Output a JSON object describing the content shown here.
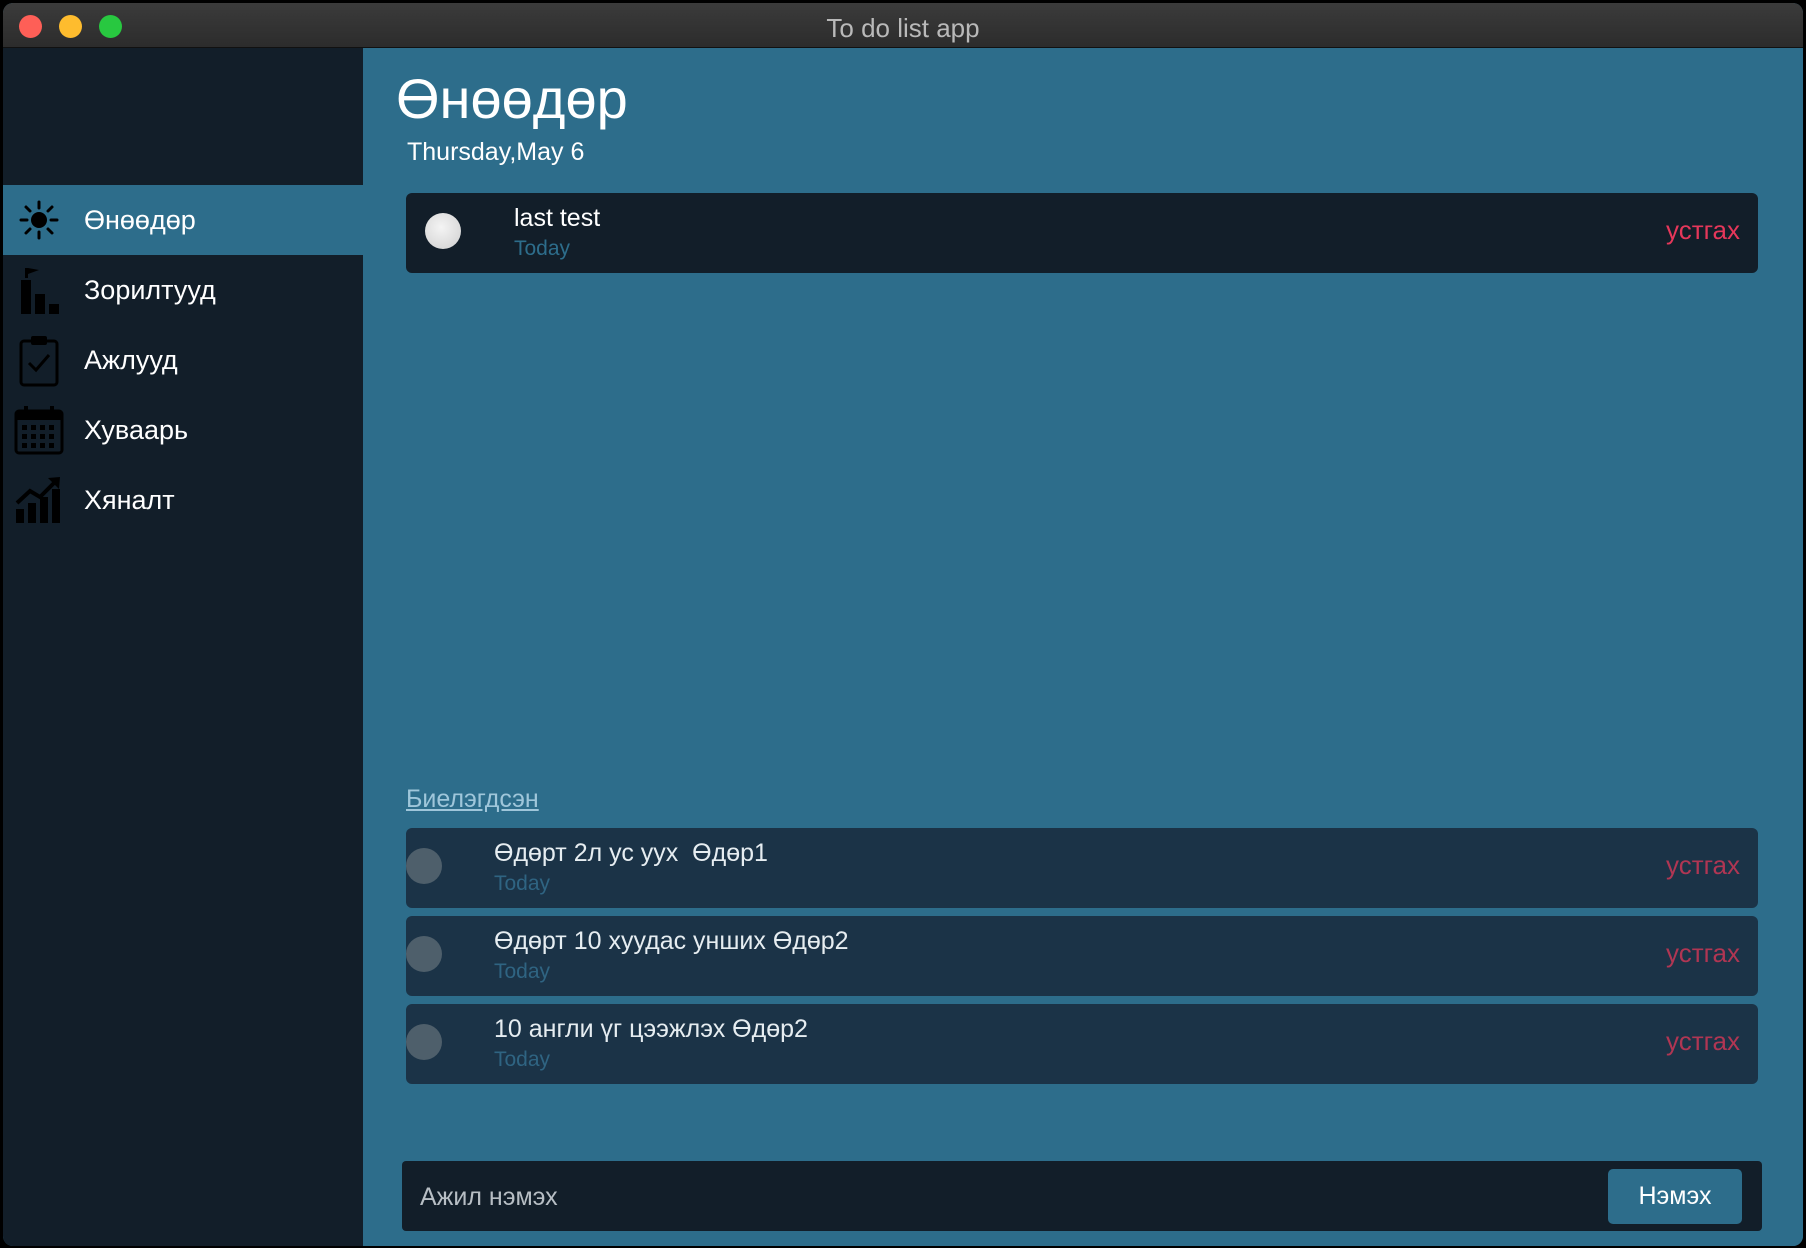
{
  "window": {
    "title": "To do list app"
  },
  "sidebar": {
    "items": [
      {
        "label": "Өнөөдөр",
        "icon": "sun-icon",
        "active": true
      },
      {
        "label": "Зорилтууд",
        "icon": "goals-flag-icon",
        "active": false
      },
      {
        "label": "Ажлууд",
        "icon": "clipboard-check-icon",
        "active": false
      },
      {
        "label": "Хуваарь",
        "icon": "calendar-icon",
        "active": false
      },
      {
        "label": "Хяналт",
        "icon": "growth-chart-icon",
        "active": false
      }
    ]
  },
  "main": {
    "title": "Өнөөдөр",
    "date": "Thursday,May 6",
    "open_tasks": [
      {
        "title": "last test",
        "due": "Today",
        "delete_label": "устгах"
      }
    ],
    "completed_label": "Биелэгдсэн",
    "completed_tasks": [
      {
        "title": "Өдөрт 2л ус уух  Өдөр1",
        "due": "Today",
        "delete_label": "устгах"
      },
      {
        "title": "Өдөрт 10 хуудас унших Өдөр2",
        "due": "Today",
        "delete_label": "устгах"
      },
      {
        "title": "10 англи үг цээжлэх Өдөр2",
        "due": "Today",
        "delete_label": "устгах"
      }
    ],
    "add": {
      "placeholder": "Ажил нэмэх",
      "button_label": "Нэмэх"
    }
  },
  "colors": {
    "accent": "#2d6d8b",
    "sidebar_bg": "#121e29",
    "delete": "#e5375a"
  }
}
